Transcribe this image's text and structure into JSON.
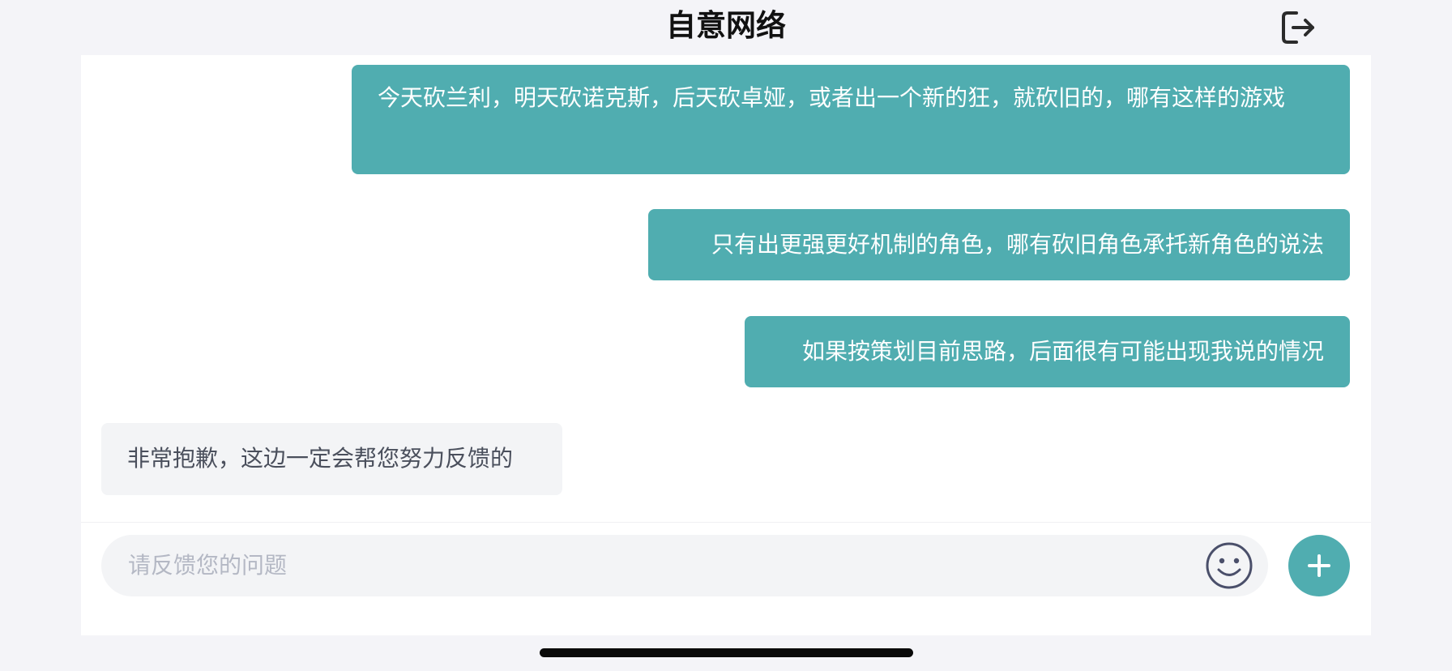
{
  "header": {
    "title": "自意网络",
    "logout_icon": "logout-icon"
  },
  "messages": [
    {
      "direction": "outgoing",
      "text": "今天砍兰利，明天砍诺克斯，后天砍卓娅，或者出一个新的狂，就砍旧的，哪有这样的游戏"
    },
    {
      "direction": "outgoing",
      "text": "只有出更强更好机制的角色，哪有砍旧角色承托新角色的说法"
    },
    {
      "direction": "outgoing",
      "text": "如果按策划目前思路，后面很有可能出现我说的情况"
    },
    {
      "direction": "incoming",
      "text": "非常抱歉，这边一定会帮您努力反馈的"
    }
  ],
  "composer": {
    "placeholder": "请反馈您的问题",
    "emoji_icon": "smiley-icon",
    "add_icon": "plus-icon"
  },
  "colors": {
    "accent": "#50adb0",
    "background": "#f4f4f8",
    "panel": "#ffffff",
    "incoming_bubble": "#f3f4f6",
    "incoming_text": "#4a4f5c",
    "placeholder_text": "#b4b8c4"
  }
}
